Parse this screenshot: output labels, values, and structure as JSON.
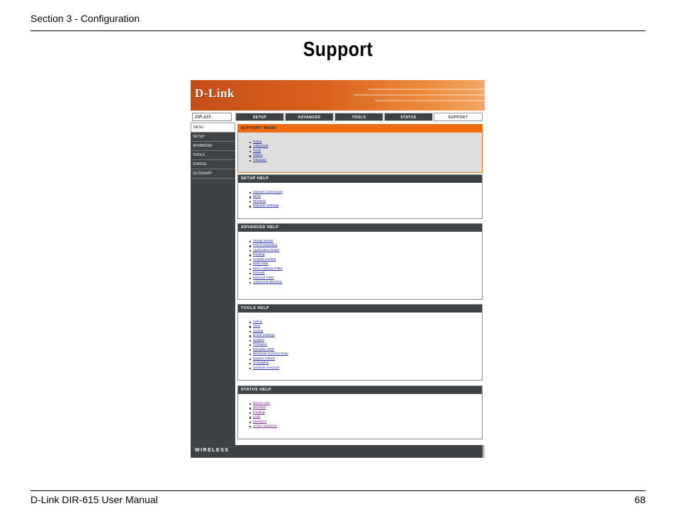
{
  "page": {
    "header": "Section 3 - Configuration",
    "title": "Support",
    "footer_left": "D-Link DIR-615 User Manual",
    "footer_right": "68"
  },
  "screenshot": {
    "logo": "D-Link",
    "model": "DIR-615",
    "tabs": [
      "SETUP",
      "ADVANCED",
      "TOOLS",
      "STATUS",
      "SUPPORT"
    ],
    "active_tab": "SUPPORT",
    "sidebar": [
      "MENU",
      "SETUP",
      "ADVANCED",
      "TOOLS",
      "STATUS",
      "GLOSSARY"
    ],
    "support_menu": {
      "title": "SUPPORT MENU",
      "items": [
        "Setup",
        "Advanced",
        "Tools",
        "Status",
        "Glossary"
      ]
    },
    "setup_help": {
      "title": "SETUP HELP",
      "items": [
        "Internet Connection",
        "WAN",
        "Wireless",
        "Network Settings"
      ]
    },
    "advanced_help": {
      "title": "ADVANCED HELP",
      "items": [
        "Virtual Server",
        "Port Forwarding",
        "Application Rules",
        "Routing",
        "Access Control",
        "Web Filter",
        "MAC Address Filter",
        "Firewall",
        "Inbound Filter",
        "Advanced Wireless"
      ]
    },
    "tools_help": {
      "title": "TOOLS HELP",
      "items": [
        "Admin",
        "Time",
        "Syslog",
        "Email Settings",
        "System",
        "Firmware",
        "Dynamic DNS",
        "Windows Connect Now",
        "System Check",
        "Schedules",
        "Sentinel Services"
      ]
    },
    "status_help": {
      "title": "STATUS HELP",
      "items": [
        "Device Info",
        "Wireless",
        "Routing",
        "Logs",
        "Statistics",
        "Active Sessions"
      ]
    },
    "bottom_label": "WIRELESS"
  },
  "colors": {
    "banner_orange": "#d9621e",
    "nav_dark": "#3e4244",
    "support_head": "#ef6b12",
    "link_blue": "#1f2b9c",
    "link_visited": "#7a1f8a"
  }
}
